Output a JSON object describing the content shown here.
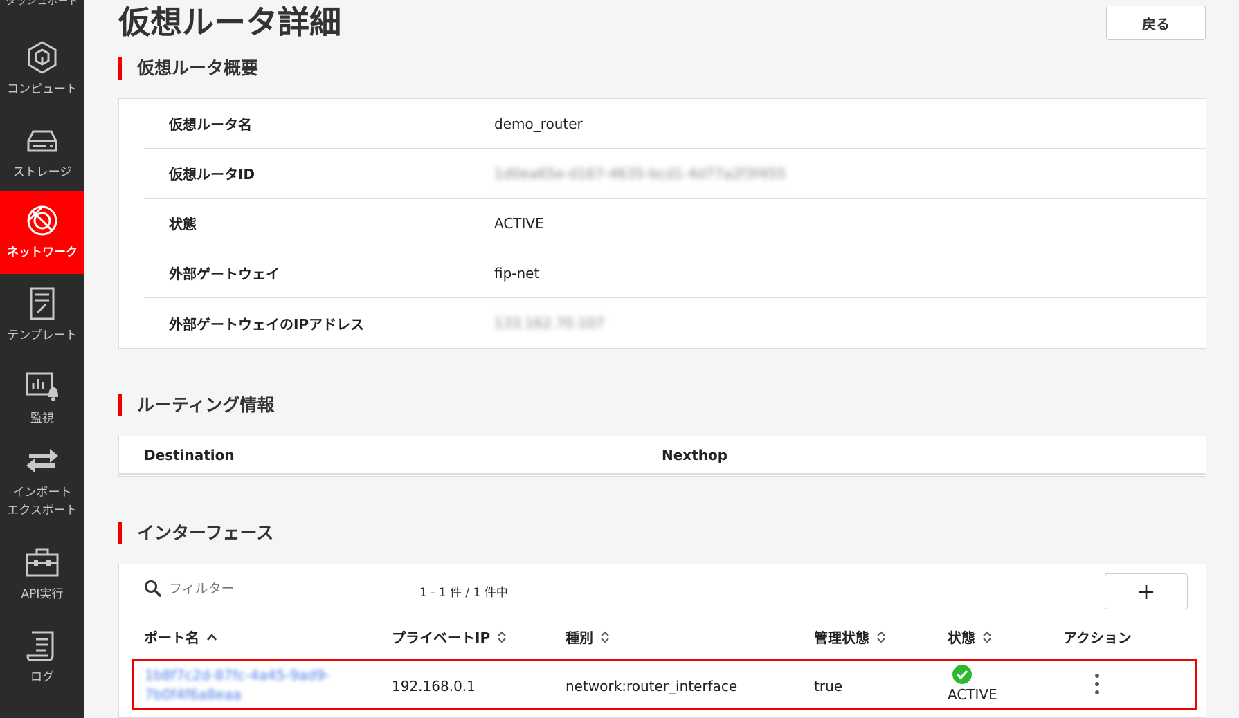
{
  "sidebar": {
    "top_cut_label": "ダッシュボード",
    "items": [
      {
        "label": "コンピュート",
        "icon": "cube-icon",
        "active": false
      },
      {
        "label": "ストレージ",
        "icon": "storage-icon",
        "active": false
      },
      {
        "label": "ネットワーク",
        "icon": "network-globe-icon",
        "active": true
      },
      {
        "label": "テンプレート",
        "icon": "template-icon",
        "active": false
      },
      {
        "label": "監視",
        "icon": "monitor-chart-icon",
        "active": false
      },
      {
        "label": "インポート\nエクスポート",
        "icon": "import-export-icon",
        "active": false
      },
      {
        "label": "API実行",
        "icon": "toolbox-icon",
        "active": false
      },
      {
        "label": "ログ",
        "icon": "log-scroll-icon",
        "active": false
      }
    ]
  },
  "header": {
    "title": "仮想ルータ詳細",
    "back_label": "戻る"
  },
  "overview": {
    "section_title": "仮想ルータ概要",
    "rows": [
      {
        "key": "仮想ルータ名",
        "value": "demo_router",
        "blurred": false
      },
      {
        "key": "仮想ルータID",
        "value": "1d0ea65e-d167-4635-bcd1-4d77a2f3f455",
        "blurred": true
      },
      {
        "key": "状態",
        "value": "ACTIVE",
        "blurred": false
      },
      {
        "key": "外部ゲートウェイ",
        "value": "fip-net",
        "blurred": false
      },
      {
        "key": "外部ゲートウェイのIPアドレス",
        "value": "133.162.70.107",
        "blurred": true
      }
    ]
  },
  "routing": {
    "section_title": "ルーティング情報",
    "columns": [
      "Destination",
      "Nexthop"
    ]
  },
  "interfaces": {
    "section_title": "インターフェース",
    "filter_placeholder": "フィルター",
    "count_text": "1 - 1 件 / 1 件中",
    "add_label": "+",
    "columns": [
      "ポート名",
      "プライベートIP",
      "種別",
      "管理状態",
      "状態",
      "アクション"
    ],
    "sort_up": "^",
    "sort_both": "⌃⌄",
    "rows": [
      {
        "port_name_line1": "1b8f7c2d-87fc-4a45-9ad9-",
        "port_name_line2": "7b0f4f6a8eaa",
        "private_ip": "192.168.0.1",
        "type": "network:router_interface",
        "admin_state": "true",
        "status": "ACTIVE"
      }
    ]
  },
  "colors": {
    "accent": "#ff0000",
    "sidebar_bg": "#2b2b2b",
    "link": "#4a7de8",
    "status_ok": "#2eb82e"
  }
}
